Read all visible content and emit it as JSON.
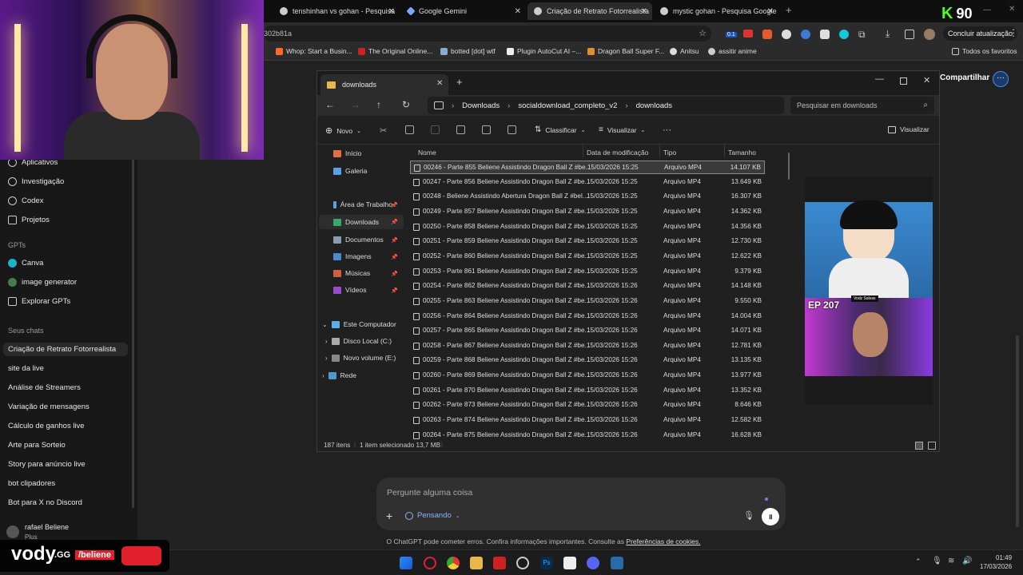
{
  "browser": {
    "tabs": [
      {
        "label": "tenshinhan vs gohan - Pesquisa",
        "active": false
      },
      {
        "label": "Google Gemini",
        "active": false
      },
      {
        "label": "Criação de Retrato Fotorrealista",
        "active": true
      },
      {
        "label": "mystic gohan - Pesquisa Google",
        "active": false
      }
    ],
    "new_tab": "+",
    "url": "302b81a",
    "update_button": "Concluir atualização",
    "bookmarks": [
      "Whop: Start a Busin...",
      "The Original Online...",
      "botted [dot] wtf",
      "Plugin AutoCut AI –...",
      "Dragon Ball Super F...",
      "Anitsu",
      "assitir anime"
    ],
    "favorites": "Todos os favoritos",
    "ext_badge": "0.1"
  },
  "overlay": {
    "k_logo": "K",
    "k_number": "90",
    "vody_brand": "vody",
    "vody_gg": ".GG",
    "vody_user": "/beliene"
  },
  "sidebar": {
    "items": [
      {
        "label": "Aplicativos",
        "icon": "apps-icon"
      },
      {
        "label": "Investigação",
        "icon": "research-icon"
      },
      {
        "label": "Codex",
        "icon": "codex-icon"
      },
      {
        "label": "Projetos",
        "icon": "folder-icon"
      }
    ],
    "gpts_header": "GPTs",
    "gpts": [
      {
        "label": "Canva",
        "icon": "canva-icon"
      },
      {
        "label": "image generator",
        "icon": "image-generator-icon"
      },
      {
        "label": "Explorar GPTs",
        "icon": "explore-icon"
      }
    ],
    "chats_header": "Seus chats",
    "chats": [
      "Criação de Retrato Fotorrealista",
      "site da live",
      "Análise de Streamers",
      "Variação de mensagens",
      "Cálculo de ganhos live",
      "Arte para Sorteio",
      "Story para anúncio live",
      "bot clipadores",
      "Bot para X no Discord"
    ],
    "user_name": "rafael Beliene",
    "user_plan": "Plus"
  },
  "header": {
    "share": "Compartilhar"
  },
  "explorer": {
    "tab_title": "downloads",
    "breadcrumb": [
      "Downloads",
      "socialdownload_completo_v2",
      "downloads"
    ],
    "search_placeholder": "Pesquisar em downloads",
    "toolbar": {
      "new": "Novo",
      "sort": "Classificar",
      "view": "Visualizar",
      "more": "···",
      "preview": "Visualizar"
    },
    "nav": {
      "home": "Início",
      "gallery": "Galeria",
      "desktop": "Área de Trabalho",
      "downloads": "Downloads",
      "documents": "Documentos",
      "images": "Imagens",
      "music": "Músicas",
      "videos": "Vídeos",
      "this_pc": "Este Computador",
      "disk_c": "Disco Local (C:)",
      "disk_e": "Novo volume (E:)",
      "network": "Rede"
    },
    "columns": {
      "name": "Nome",
      "date": "Data de modificação",
      "type": "Tipo",
      "size": "Tamanho"
    },
    "files": [
      {
        "name": "00246 - Parte 855 Beliene Assistindo Dragon Ball Z #be...",
        "date": "15/03/2026 15:25",
        "type": "Arquivo MP4",
        "size": "14.107 KB"
      },
      {
        "name": "00247 - Parte 856 Beliene Assistindo Dragon Ball Z #be...",
        "date": "15/03/2026 15:25",
        "type": "Arquivo MP4",
        "size": "13.649 KB"
      },
      {
        "name": "00248 - Beliene Assistindo Abertura Dragon Ball Z #bel...",
        "date": "15/03/2026 15:25",
        "type": "Arquivo MP4",
        "size": "16.307 KB"
      },
      {
        "name": "00249 - Parte 857 Beliene Assistindo Dragon Ball Z #be...",
        "date": "15/03/2026 15:25",
        "type": "Arquivo MP4",
        "size": "14.362 KB"
      },
      {
        "name": "00250 - Parte 858 Beliene Assistindo Dragon Ball Z #be...",
        "date": "15/03/2026 15:25",
        "type": "Arquivo MP4",
        "size": "14.356 KB"
      },
      {
        "name": "00251 - Parte 859 Beliene Assistindo Dragon Ball Z #be...",
        "date": "15/03/2026 15:25",
        "type": "Arquivo MP4",
        "size": "12.730 KB"
      },
      {
        "name": "00252 - Parte 860 Beliene Assistindo Dragon Ball Z #be...",
        "date": "15/03/2026 15:25",
        "type": "Arquivo MP4",
        "size": "12.622 KB"
      },
      {
        "name": "00253 - Parte 861 Beliene Assistindo Dragon Ball Z #be...",
        "date": "15/03/2026 15:25",
        "type": "Arquivo MP4",
        "size": "9.379 KB"
      },
      {
        "name": "00254 - Parte 862 Beliene Assistindo Dragon Ball Z #be...",
        "date": "15/03/2026 15:26",
        "type": "Arquivo MP4",
        "size": "14.148 KB"
      },
      {
        "name": "00255 - Parte 863 Beliene Assistindo Dragon Ball Z #be...",
        "date": "15/03/2026 15:26",
        "type": "Arquivo MP4",
        "size": "9.550 KB"
      },
      {
        "name": "00256 - Parte 864 Beliene Assistindo Dragon Ball Z #be...",
        "date": "15/03/2026 15:26",
        "type": "Arquivo MP4",
        "size": "14.004 KB"
      },
      {
        "name": "00257 - Parte 865 Beliene Assistindo Dragon Ball Z #be...",
        "date": "15/03/2026 15:26",
        "type": "Arquivo MP4",
        "size": "14.071 KB"
      },
      {
        "name": "00258 - Parte 867 Beliene Assistindo Dragon Ball Z #be...",
        "date": "15/03/2026 15:26",
        "type": "Arquivo MP4",
        "size": "12.781 KB"
      },
      {
        "name": "00259 - Parte 868 Beliene Assistindo Dragon Ball Z #be...",
        "date": "15/03/2026 15:26",
        "type": "Arquivo MP4",
        "size": "13.135 KB"
      },
      {
        "name": "00260 - Parte 869 Beliene Assistindo Dragon Ball Z #be...",
        "date": "15/03/2026 15:26",
        "type": "Arquivo MP4",
        "size": "13.977 KB"
      },
      {
        "name": "00261 - Parte 870 Beliene Assistindo Dragon Ball Z #be...",
        "date": "15/03/2026 15:26",
        "type": "Arquivo MP4",
        "size": "13.352 KB"
      },
      {
        "name": "00262 - Parte 873 Beliene Assistindo Dragon Ball Z #be...",
        "date": "15/03/2026 15:26",
        "type": "Arquivo MP4",
        "size": "8.646 KB"
      },
      {
        "name": "00263 - Parte 874 Beliene Assistindo Dragon Ball Z #be...",
        "date": "15/03/2026 15:26",
        "type": "Arquivo MP4",
        "size": "12.582 KB"
      },
      {
        "name": "00264 - Parte 875 Beliene Assistindo Dragon Ball Z #be...",
        "date": "15/03/2026 15:26",
        "type": "Arquivo MP4",
        "size": "16.628 KB"
      }
    ],
    "status_count": "187 itens",
    "status_selected": "1 item selecionado 13,7 MB",
    "preview_ep": "EP 207",
    "preview_tag": "Vodz Salvas"
  },
  "composer": {
    "placeholder": "Pergunte alguma coisa",
    "mode": "Pensando"
  },
  "footer": {
    "note": "O ChatGPT pode cometer erros. Confira informações importantes. Consulte as",
    "link": "Preferências de cookies."
  },
  "taskbar": {
    "time": "01:49",
    "date": "17/03/2026"
  }
}
